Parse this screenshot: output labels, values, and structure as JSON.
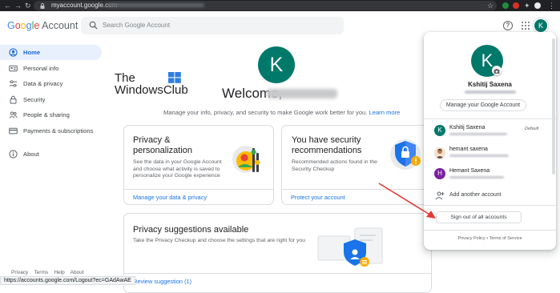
{
  "browser": {
    "url_domain": "myaccount.google.com",
    "status_url": "https://accounts.google.com/Logout?ec=GAdAwAE"
  },
  "header": {
    "logo_google": "Google",
    "logo_account": "Account",
    "search_placeholder": "Search Google Account",
    "help_glyph": "?",
    "avatar_letter": "K"
  },
  "sidebar": {
    "items": [
      {
        "label": "Home",
        "icon": "home-icon",
        "active": true
      },
      {
        "label": "Personal info",
        "icon": "personal-info-icon"
      },
      {
        "label": "Data & privacy",
        "icon": "data-privacy-icon"
      },
      {
        "label": "Security",
        "icon": "lock-icon"
      },
      {
        "label": "People & sharing",
        "icon": "people-icon"
      },
      {
        "label": "Payments & subscriptions",
        "icon": "payment-card-icon"
      },
      {
        "label": "About",
        "icon": "info-icon"
      }
    ]
  },
  "main": {
    "avatar_letter": "K",
    "watermark_line1": "The",
    "watermark_line2": "WindowsClub",
    "welcome": "Welcome,",
    "subtitle": "Manage your info, privacy, and security to make Google work better for you.",
    "subtitle_link": "Learn more",
    "cards": [
      {
        "title": "Privacy & personalization",
        "desc": "See the data in your Google Account and choose what activity is saved to personalize your Google experience",
        "link": "Manage your data & privacy"
      },
      {
        "title": "You have security recommendations",
        "desc": "Recommended actions found in the Security Checkup",
        "link": "Protect your account"
      },
      {
        "title": "Privacy suggestions available",
        "desc": "Take the Privacy Checkup and choose the settings that are right for you",
        "link": "Review suggestion (1)"
      }
    ]
  },
  "footer": {
    "links": [
      "Privacy",
      "Terms",
      "Help",
      "About"
    ]
  },
  "popup": {
    "avatar_letter": "K",
    "name": "Kshitij Saxena",
    "manage_label": "Manage your Google Account",
    "accounts": [
      {
        "letter": "K",
        "name": "Kshitij Saxena",
        "color": "#00796b",
        "tag": "Default"
      },
      {
        "letter": "",
        "name": "hemant saxena",
        "color": "#c58a5c",
        "tag": ""
      },
      {
        "letter": "H",
        "name": "Hemant Saxena",
        "color": "#7b1fa2",
        "tag": ""
      }
    ],
    "add_account": "Add another account",
    "sign_out": "Sign out of all accounts",
    "footer_privacy": "Privacy Policy",
    "footer_sep": "•",
    "footer_terms": "Terms of Service"
  },
  "colors": {
    "accent": "#1a73e8",
    "active_nav_bg": "#e8f0fe",
    "avatar_teal": "#00796b",
    "annotation_arrow": "#e53935"
  }
}
